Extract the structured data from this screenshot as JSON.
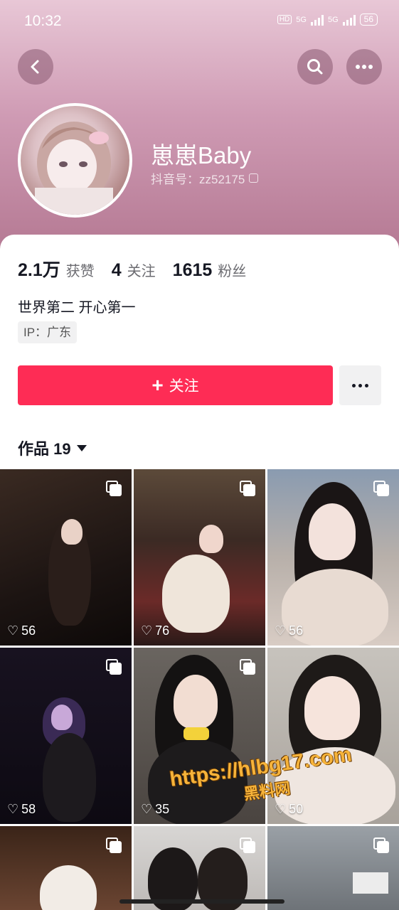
{
  "status_bar": {
    "time": "10:32",
    "hd": "HD",
    "network1": "5G",
    "network2": "5G",
    "battery": "56"
  },
  "header": {
    "back_icon": "back-chevron-icon",
    "search_icon": "search-icon",
    "more_icon": "more-dots-icon"
  },
  "profile": {
    "username": "崽崽Baby",
    "douyin_id": "抖音号：zz52175",
    "stats": [
      {
        "value": "2.1万",
        "label": "获赞"
      },
      {
        "value": "4",
        "label": "关注"
      },
      {
        "value": "1615",
        "label": "粉丝"
      }
    ],
    "bio": "世界第二 开心第一",
    "ip": "IP：广东"
  },
  "actions": {
    "follow_label": "关注"
  },
  "works": {
    "tab_label": "作品 19"
  },
  "tiles": [
    {
      "likes": "56"
    },
    {
      "likes": "76"
    },
    {
      "likes": "56"
    },
    {
      "likes": "58"
    },
    {
      "likes": "35"
    },
    {
      "likes": "50"
    }
  ],
  "watermark": {
    "url": "https://hlbg17.com",
    "name": "黑料网"
  }
}
